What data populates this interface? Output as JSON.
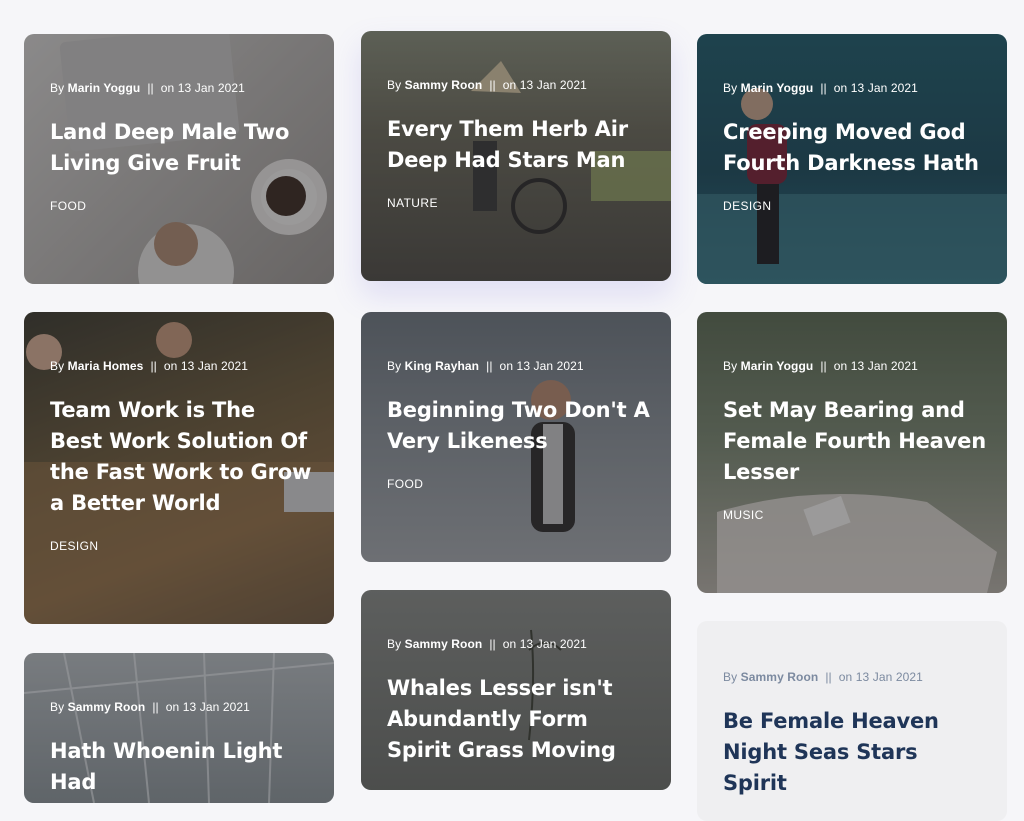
{
  "meta_prefix": "By",
  "meta_separator": "||",
  "meta_on": "on",
  "cards": [
    {
      "author": "Marin Yoggu",
      "date": "13 Jan 2021",
      "title": "Land Deep Male Two Living Give Fruit",
      "category": "FOOD"
    },
    {
      "author": "Sammy Roon",
      "date": "13 Jan 2021",
      "title": "Every Them Herb Air Deep Had Stars Man",
      "category": "NATURE"
    },
    {
      "author": "Marin Yoggu",
      "date": "13 Jan 2021",
      "title": "Creeping Moved God Fourth Darkness Hath",
      "category": "DESIGN"
    },
    {
      "author": "Maria Homes",
      "date": "13 Jan 2021",
      "title": "Team Work is The Best Work Solution Of the Fast Work to Grow a Better World",
      "category": "DESIGN"
    },
    {
      "author": "King Rayhan",
      "date": "13 Jan 2021",
      "title": "Beginning Two Don't A Very Likeness",
      "category": "FOOD"
    },
    {
      "author": "Marin Yoggu",
      "date": "13 Jan 2021",
      "title": "Set May Bearing and Female Fourth Heaven Lesser",
      "category": "MUSIC"
    },
    {
      "author": "Sammy Roon",
      "date": "13 Jan 2021",
      "title": "Hath Whoenin Light Had",
      "category": ""
    },
    {
      "author": "Sammy Roon",
      "date": "13 Jan 2021",
      "title": "Whales Lesser isn't Abundantly Form Spirit Grass Moving",
      "category": ""
    },
    {
      "author": "Sammy Roon",
      "date": "13 Jan 2021",
      "title": "Be Female Heaven Night Seas Stars Spirit",
      "category": ""
    }
  ],
  "colors": {
    "page_bg": "#f6f6f9",
    "light_card_title": "#1f3558",
    "light_card_meta": "#7c8aa0"
  }
}
